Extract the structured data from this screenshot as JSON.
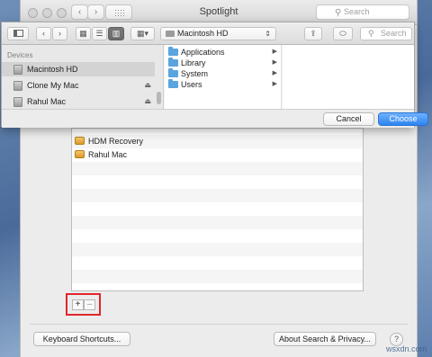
{
  "pref_window": {
    "title": "Spotlight",
    "search_placeholder": "Search",
    "back_glyph": "‹",
    "forward_glyph": "›",
    "privacy_list": [
      "HDM Recovery",
      "Rahul Mac"
    ],
    "add_glyph": "+",
    "remove_glyph": "–",
    "keyboard_shortcuts_label": "Keyboard Shortcuts...",
    "about_label": "About Search & Privacy...",
    "help_glyph": "?"
  },
  "sheet": {
    "path_label": "Macintosh HD",
    "search_placeholder": "Search",
    "sidebar_heading": "Devices",
    "sidebar_items": [
      {
        "label": "Macintosh HD",
        "selected": true,
        "eject": ""
      },
      {
        "label": "Clone My Mac",
        "selected": false,
        "eject": "⏏"
      },
      {
        "label": "Rahul Mac",
        "selected": false,
        "eject": "⏏"
      }
    ],
    "folders": [
      {
        "label": "Applications",
        "arrow": "▶"
      },
      {
        "label": "Library",
        "arrow": "▶"
      },
      {
        "label": "System",
        "arrow": "▶"
      },
      {
        "label": "Users",
        "arrow": "▶"
      }
    ],
    "cancel_label": "Cancel",
    "choose_label": "Choose"
  },
  "watermark": "wsxdn.com",
  "colors": {
    "accent": "#2f84ef",
    "highlight_box": "#e0262c",
    "folder": "#5aa4e0"
  }
}
